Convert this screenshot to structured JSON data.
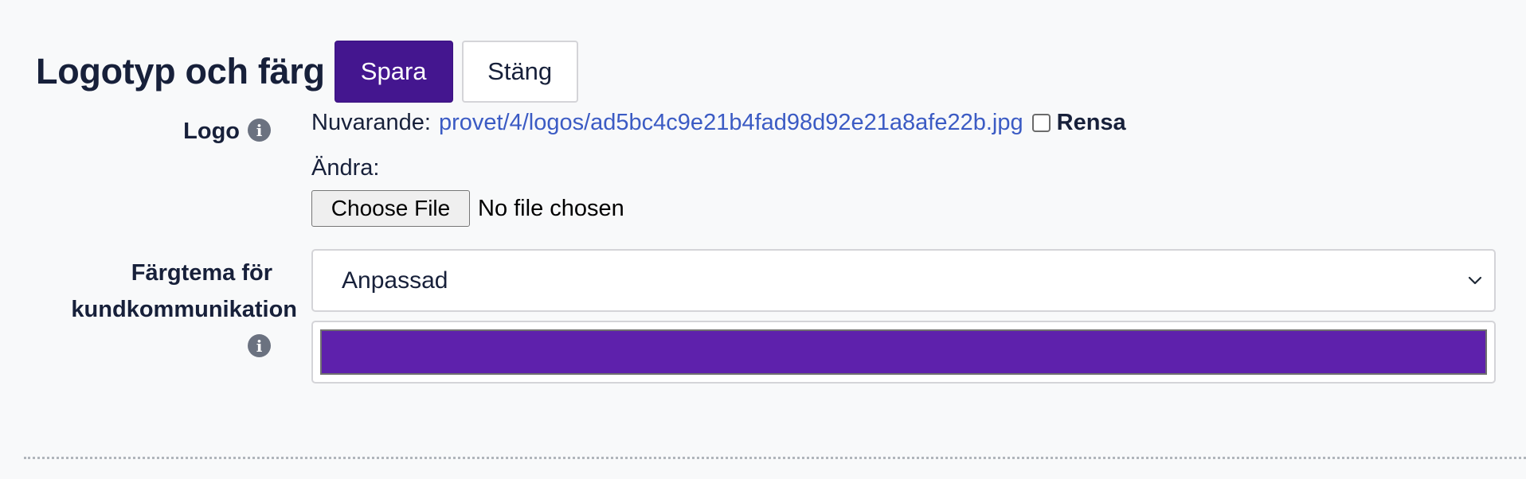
{
  "header": {
    "title": "Logotyp och färg",
    "save_label": "Spara",
    "close_label": "Stäng"
  },
  "logo": {
    "label": "Logo",
    "current_prefix": "Nuvarande:",
    "current_file": "provet/4/logos/ad5bc4c9e21b4fad98d92e21a8afe22b.jpg",
    "clear_checked": false,
    "clear_label": "Rensa",
    "change_label": "Ändra:",
    "file_button_label": "Choose File",
    "file_status": "No file chosen"
  },
  "theme": {
    "label_line1": "Färgtema för",
    "label_line2": "kundkommunikation",
    "selected_option": "Anpassad",
    "color_value": "#5e21ac"
  },
  "colors": {
    "primary_button": "#44168f",
    "link": "#3b5bc4",
    "info_icon": "#6b7280"
  },
  "icons": {
    "info": "info-icon",
    "select_arrow": "chevron-down-icon"
  }
}
